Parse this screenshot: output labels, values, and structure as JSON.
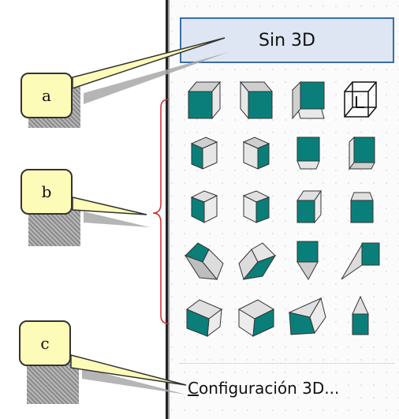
{
  "menu": {
    "no3d_label": "Sin 3D",
    "config_label_first": "C",
    "config_label_rest": "onfiguración 3D..."
  },
  "shapes": [
    [
      "style-1",
      "style-2",
      "style-3",
      "style-4-wireframe"
    ],
    [
      "style-5",
      "style-6",
      "style-7",
      "style-8"
    ],
    [
      "style-9",
      "style-10",
      "style-11",
      "style-12"
    ],
    [
      "style-13",
      "style-14",
      "style-15",
      "style-16"
    ],
    [
      "style-17",
      "style-18",
      "style-19",
      "style-20"
    ]
  ],
  "callouts": {
    "a": "a",
    "b": "b",
    "c": "c"
  },
  "colors": {
    "teal": "#0a7f7a",
    "callout_fill": "#fdfbb8",
    "bracket": "#d4282d",
    "selected_border": "#3a6ea5"
  },
  "icons": {
    "shape_icon": "3d-cube-icon",
    "wireframe_icon": "wireframe-cube-icon"
  }
}
